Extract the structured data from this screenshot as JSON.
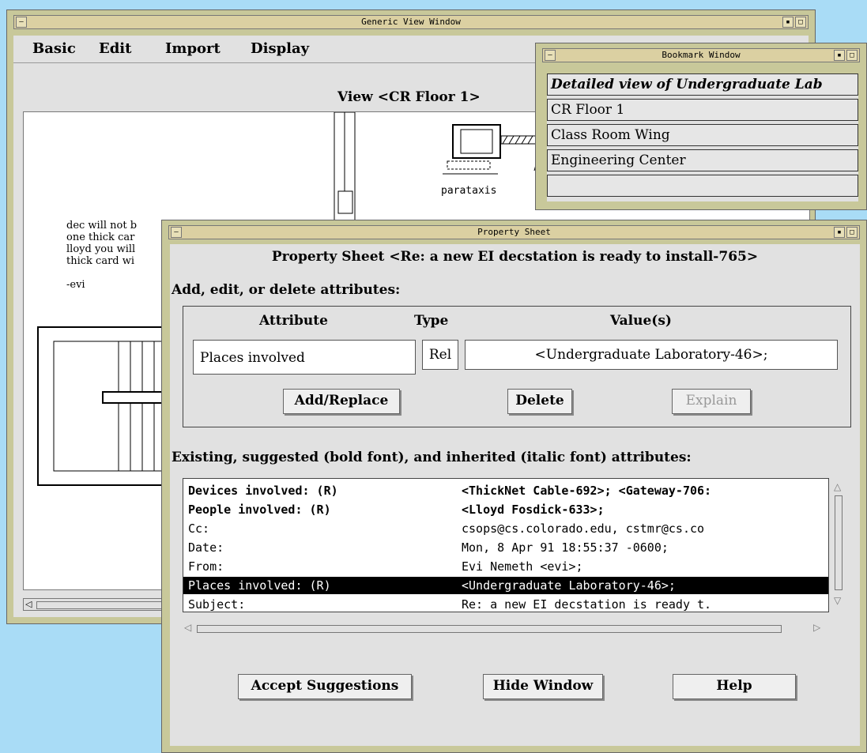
{
  "generic_window": {
    "title": "Generic View Window",
    "menu": [
      "Basic",
      "Edit",
      "Import",
      "Display"
    ],
    "view_label": "View <CR Floor 1>",
    "device_label": "parataxis",
    "note_lines": [
      "dec will not b",
      "one thick car",
      "lloyd you will",
      "thick card wi",
      "",
      "-evi"
    ]
  },
  "bookmark_window": {
    "title": "Bookmark Window",
    "items": [
      {
        "label": "Detailed view of Undergraduate Lab",
        "italic": true
      },
      {
        "label": "CR Floor 1",
        "italic": false
      },
      {
        "label": "Class Room Wing",
        "italic": false
      },
      {
        "label": "Engineering Center",
        "italic": false
      },
      {
        "label": "",
        "italic": false
      }
    ]
  },
  "property_sheet": {
    "title": "Property Sheet",
    "heading": "Property Sheet <Re: a new EI decstation is ready to install-765>",
    "add_edit_label": "Add, edit, or delete attributes:",
    "col_attribute": "Attribute",
    "col_type": "Type",
    "col_values": "Value(s)",
    "attribute_value": "Places involved",
    "type_value": "Rel",
    "values_value": "<Undergraduate Laboratory-46>;",
    "add_replace": "Add/Replace",
    "delete": "Delete",
    "explain": "Explain",
    "existing_label": "Existing, suggested (bold font), and inherited (italic font) attributes:",
    "rows": [
      {
        "key": "Devices involved: (R)",
        "value": "<ThickNet Cable-692>; <Gateway-706:",
        "bold": true,
        "selected": false
      },
      {
        "key": "People involved: (R)",
        "value": "<Lloyd Fosdick-633>;",
        "bold": true,
        "selected": false
      },
      {
        "key": "Cc:",
        "value": "csops@cs.colorado.edu, cstmr@cs.co",
        "bold": false,
        "selected": false
      },
      {
        "key": "Date:",
        "value": "Mon, 8 Apr 91 18:55:37 -0600;",
        "bold": false,
        "selected": false
      },
      {
        "key": "From:",
        "value": "Evi Nemeth <evi>;",
        "bold": false,
        "selected": false
      },
      {
        "key": "Places involved: (R)",
        "value": "<Undergraduate Laboratory-46>;",
        "bold": false,
        "selected": true
      },
      {
        "key": "Subject:",
        "value": "Re: a new EI decstation is ready t.",
        "bold": false,
        "selected": false
      }
    ],
    "accept": "Accept Suggestions",
    "hide": "Hide Window",
    "help": "Help"
  }
}
